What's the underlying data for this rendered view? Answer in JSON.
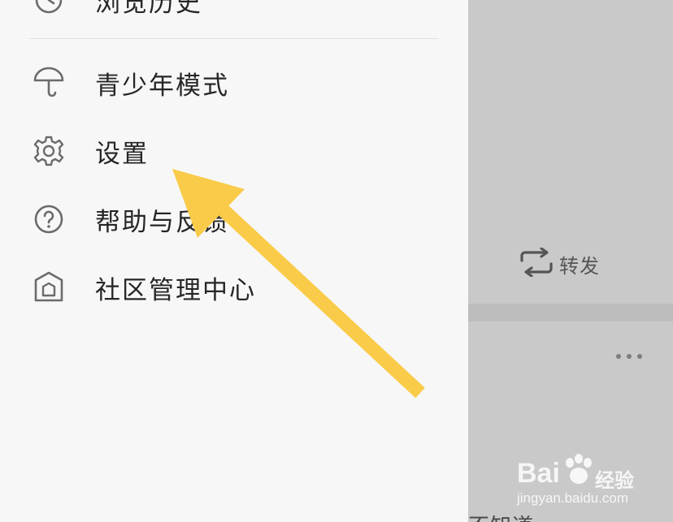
{
  "drawer": {
    "partial_top_item": {
      "label": "浏览历史",
      "icon": "history-clock-icon"
    },
    "items": [
      {
        "label": "青少年模式",
        "icon": "umbrella-icon"
      },
      {
        "label": "设置",
        "icon": "gear-icon"
      },
      {
        "label": "帮助与反馈",
        "icon": "question-circle-icon"
      },
      {
        "label": "社区管理中心",
        "icon": "shield-home-icon"
      }
    ]
  },
  "background_post": {
    "repost_label": "转发",
    "repost_icon": "repost-icon",
    "more_icon": "more-dots-icon",
    "bottom_text": "不知道"
  },
  "watermark": {
    "brand": "Bai",
    "brand_suffix": "经验",
    "url": "jingyan.baidu.com"
  },
  "annotation": {
    "type": "arrow",
    "color": "#f9cb48",
    "points_to": "设置"
  },
  "colors": {
    "drawer_bg": "#f7f7f7",
    "dim_overlay": "#c9c9c9",
    "text_primary": "#262626",
    "icon_gray": "#6b6b6b",
    "arrow_yellow": "#f9cb48"
  }
}
